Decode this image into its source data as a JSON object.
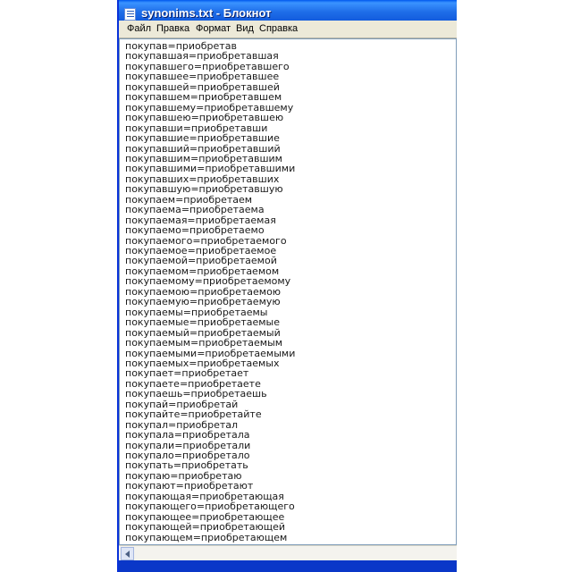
{
  "window": {
    "title": "synonims.txt - Блокнот",
    "icon": "notepad-icon"
  },
  "menu": [
    "Файл",
    "Правка",
    "Формат",
    "Вид",
    "Справка"
  ],
  "document": {
    "lines": [
      "покупав=приобретав",
      "покупавшая=приобретавшая",
      "покупавшего=приобретавшего",
      "покупавшее=приобретавшее",
      "покупавшей=приобретавшей",
      "покупавшем=приобретавшем",
      "покупавшему=приобретавшему",
      "покупавшею=приобретавшею",
      "покупавши=приобретавши",
      "покупавшие=приобретавшие",
      "покупавший=приобретавший",
      "покупавшим=приобретавшим",
      "покупавшими=приобретавшими",
      "покупавших=приобретавших",
      "покупавшую=приобретавшую",
      "покупаем=приобретаем",
      "покупаема=приобретаема",
      "покупаемая=приобретаемая",
      "покупаемо=приобретаемо",
      "покупаемого=приобретаемого",
      "покупаемое=приобретаемое",
      "покупаемой=приобретаемой",
      "покупаемом=приобретаемом",
      "покупаемому=приобретаемому",
      "покупаемою=приобретаемою",
      "покупаемую=приобретаемую",
      "покупаемы=приобретаемы",
      "покупаемые=приобретаемые",
      "покупаемый=приобретаемый",
      "покупаемым=приобретаемым",
      "покупаемыми=приобретаемыми",
      "покупаемых=приобретаемых",
      "покупает=приобретает",
      "покупаете=приобретаете",
      "покупаешь=приобретаешь",
      "покупай=приобретай",
      "покупайте=приобретайте",
      "покупал=приобретал",
      "покупала=приобретала",
      "покупали=приобретали",
      "покупало=приобретало",
      "покупать=приобретать",
      "покупаю=приобретаю",
      "покупают=приобретают",
      "покупающая=приобретающая",
      "покупающего=приобретающего",
      "покупающее=приобретающее",
      "покупающей=приобретающей",
      "покупающем=приобретающем"
    ]
  }
}
